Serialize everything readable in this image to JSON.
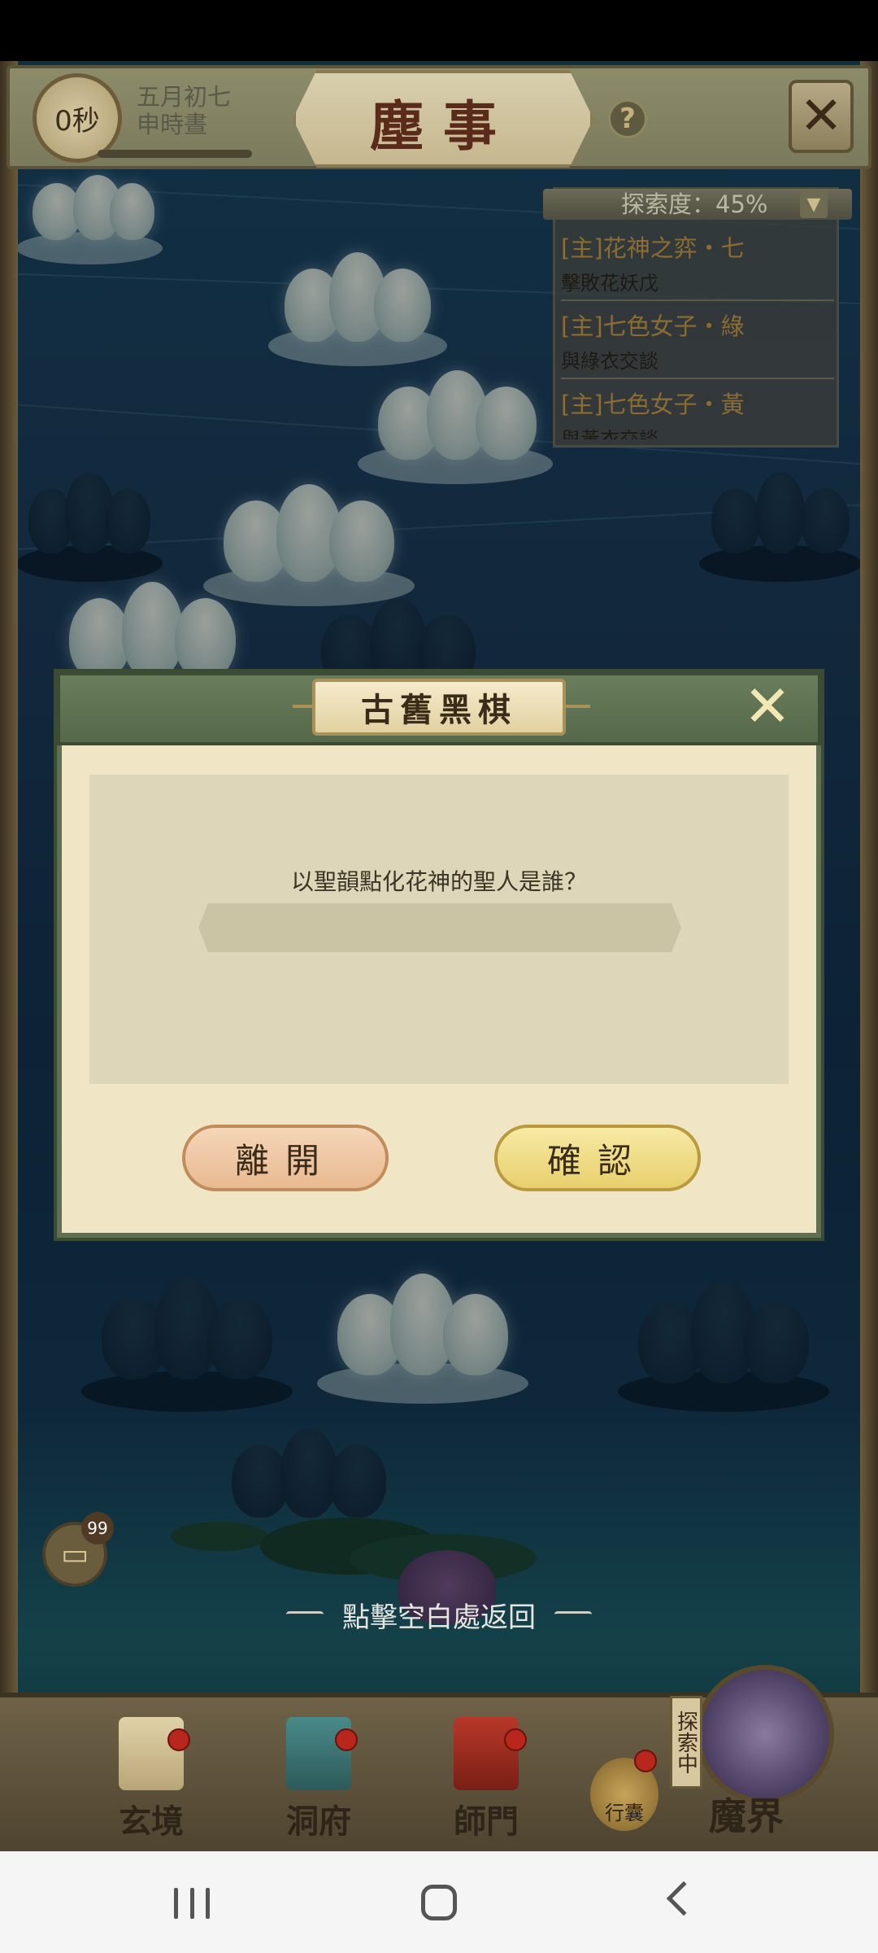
{
  "header": {
    "timer": "0秒",
    "date_line1": "五月初七",
    "date_line2": "申時晝",
    "title": "塵事",
    "help_label": "?",
    "exit_icon": "close-icon"
  },
  "quest_panel": {
    "explore_label": "探索度：45%",
    "explore_percent": 45,
    "items": [
      {
        "title": "[主]花神之弈・七",
        "subtitle": "擊敗花妖戊"
      },
      {
        "title": "[主]七色女子・綠",
        "subtitle": "與綠衣交談"
      },
      {
        "title": "[主]七色女子・黃",
        "subtitle": "與黃衣交談"
      }
    ]
  },
  "dialog": {
    "title": "古舊黑棋",
    "question": "以聖韻點化花神的聖人是誰？",
    "answer_value": "",
    "leave_label": "離開",
    "confirm_label": "確認"
  },
  "chat": {
    "badge": "99"
  },
  "hint": "點擊空白處返回",
  "bottom_nav": {
    "items": [
      {
        "label": "玄境"
      },
      {
        "label": "洞府"
      },
      {
        "label": "師門"
      }
    ],
    "bag_label": "行囊",
    "realm_tag": "探索中",
    "realm_label": "魔界"
  },
  "colors": {
    "dialog_bg": "#f0e6c6",
    "dialog_header": "#5e6f52",
    "quest_title": "#8b6c32",
    "confirm_btn": "#e7cf6c",
    "leave_btn": "#e9b990"
  }
}
